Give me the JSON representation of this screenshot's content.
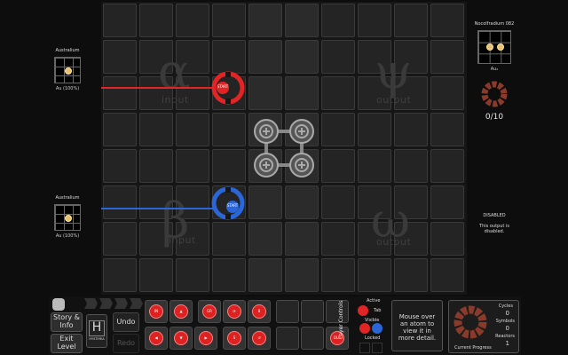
{
  "left_inputs": {
    "alpha": {
      "title": "Australium",
      "formula": "Au (100%)"
    },
    "beta": {
      "title": "Australium",
      "formula": "Au (100%)"
    }
  },
  "right_output": {
    "psi": {
      "title": "Nocolfradium 082",
      "formula": "Au₂",
      "count": "0/10"
    },
    "omega": {
      "title": "DISABLED",
      "note": "This output is disabled."
    }
  },
  "zones": {
    "alpha": {
      "symbol": "α",
      "label": "input"
    },
    "beta": {
      "symbol": "β",
      "label": "input"
    },
    "psi": {
      "symbol": "ψ",
      "label": "output"
    },
    "omega": {
      "symbol": "ω",
      "label": "output"
    }
  },
  "reactors": {
    "red_label": "START",
    "blue_label": "START"
  },
  "bottom": {
    "story_label": "Story & Info",
    "exit_label": "Exit Level",
    "undo_label": "Undo",
    "redo_label": "Redo",
    "h_label": "H",
    "h_sub": "HYSTERIA",
    "layer_controls": "Layer Controls",
    "active_label": "Active",
    "tab_label": "Tab",
    "visible_label": "Visible",
    "locked_label": "Locked",
    "info_text": "Mouse over an atom to view it in more detail.",
    "progress_title": "Current Progress",
    "cycles_label": "Cycles",
    "cycles_value": "0",
    "symbols_label": "Symbols",
    "symbols_value": "0",
    "reactors_label": "Reactors",
    "reactors_value": "1"
  },
  "colors": {
    "red": "#e22424",
    "blue": "#2a66d8",
    "gold": "#e8c070"
  }
}
